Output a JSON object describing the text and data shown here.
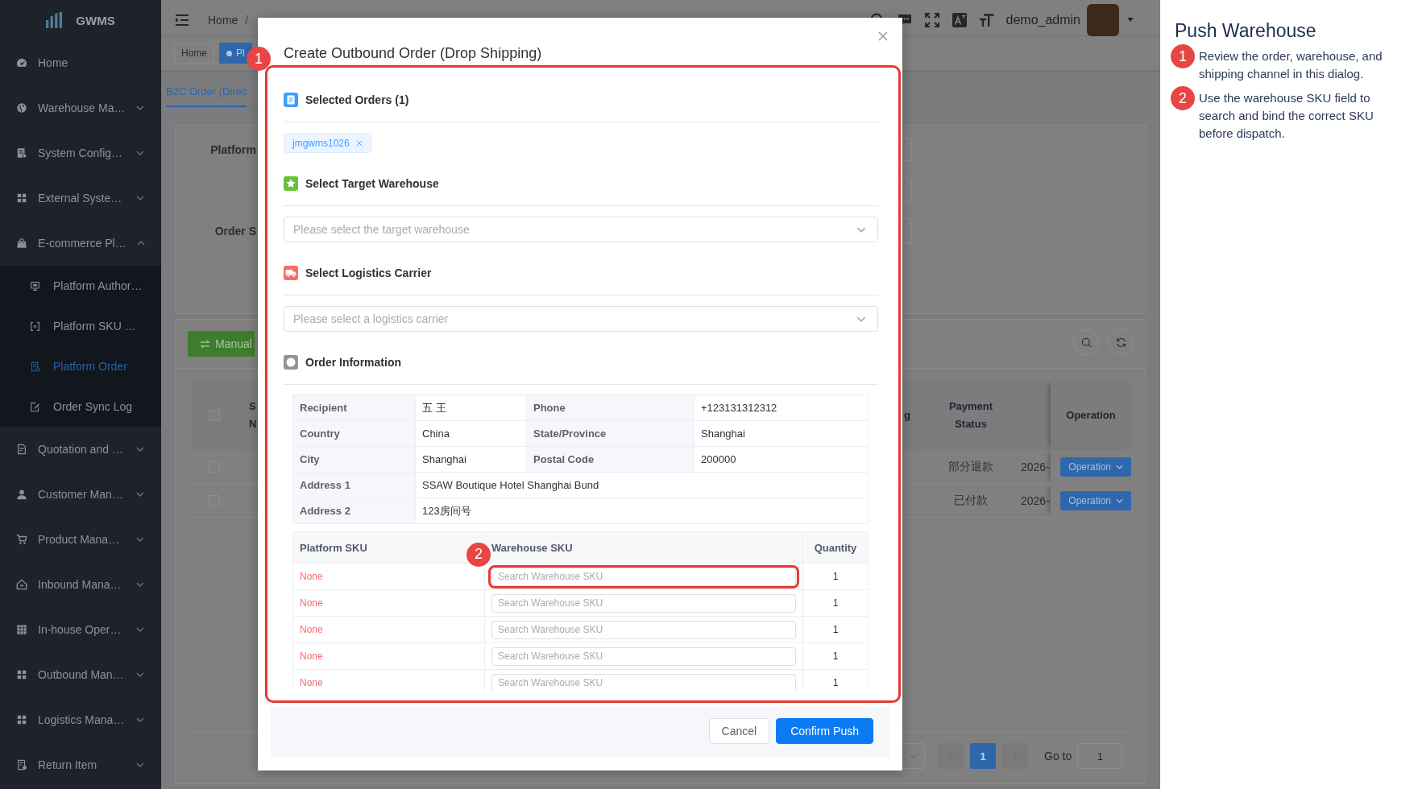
{
  "sidebar": {
    "logo": "GWMS",
    "items": [
      {
        "label": "Home",
        "kind": "link"
      },
      {
        "label": "Warehouse Ma…",
        "kind": "group",
        "expanded": false
      },
      {
        "label": "System Config…",
        "kind": "group",
        "expanded": false
      },
      {
        "label": "External Syste…",
        "kind": "group",
        "expanded": false
      },
      {
        "label": "E-commerce Pl…",
        "kind": "group",
        "expanded": true,
        "children": [
          {
            "label": "Platform Author…",
            "selected": false
          },
          {
            "label": "Platform SKU …",
            "selected": false
          },
          {
            "label": "Platform Order",
            "selected": true
          },
          {
            "label": "Order Sync Log",
            "selected": false
          }
        ]
      },
      {
        "label": "Quotation and …",
        "kind": "group",
        "expanded": false
      },
      {
        "label": "Customer Man…",
        "kind": "group",
        "expanded": false
      },
      {
        "label": "Product Mana…",
        "kind": "group",
        "expanded": false
      },
      {
        "label": "Inbound Mana…",
        "kind": "group",
        "expanded": false
      },
      {
        "label": "In-house Oper…",
        "kind": "group",
        "expanded": false
      },
      {
        "label": "Outbound Man…",
        "kind": "group",
        "expanded": false
      },
      {
        "label": "Logistics Mana…",
        "kind": "group",
        "expanded": false
      },
      {
        "label": "Return Item",
        "kind": "group",
        "expanded": false
      }
    ]
  },
  "topbar": {
    "breadcrumb": [
      {
        "label": "Home"
      }
    ],
    "separator": "/",
    "user": "demo_admin"
  },
  "tags": [
    {
      "label": "Home",
      "selected": false
    },
    {
      "label": "Pl",
      "selected": true
    }
  ],
  "page_tabs": [
    {
      "label": "B2C Order (Direc",
      "selected": true
    }
  ],
  "filter": {
    "labels": [
      "Platform",
      "Order S"
    ]
  },
  "toolbar": {
    "button": "Manual"
  },
  "table": {
    "select_all": false,
    "columns": [
      {
        "label": "S N"
      },
      {
        "label": "g"
      },
      {
        "label": "Payment Status"
      },
      {
        "label": "Operation"
      }
    ],
    "rows": [
      {
        "checked": false,
        "payment_status": "部分退款",
        "column_4": "2026-",
        "operation": "Operation"
      },
      {
        "checked": false,
        "payment_status": "已付款",
        "column_4": "2026-",
        "operation": "Operation"
      }
    ]
  },
  "pagination": {
    "pages": [
      {
        "label": "1",
        "selected": true
      }
    ],
    "goto_label": "Go to",
    "goto_value": "1"
  },
  "dialog": {
    "title": "Create Outbound Order (Drop Shipping)",
    "sections": [
      {
        "kind": "orders",
        "title": "Selected Orders (1)",
        "tags": [
          "jmgwms1026"
        ]
      },
      {
        "kind": "warehouse",
        "title": "Select Target Warehouse",
        "placeholder": "Please select the target warehouse"
      },
      {
        "kind": "carrier",
        "title": "Select Logistics Carrier",
        "placeholder": "Please select a logistics carrier"
      },
      {
        "kind": "info",
        "title": "Order Information"
      }
    ],
    "order_info": [
      {
        "cells": [
          {
            "label": "Recipient",
            "value": "五 王"
          },
          {
            "label": "Phone",
            "value": "+123131312312"
          }
        ]
      },
      {
        "cells": [
          {
            "label": "Country",
            "value": "China"
          },
          {
            "label": "State/Province",
            "value": "Shanghai"
          }
        ]
      },
      {
        "cells": [
          {
            "label": "City",
            "value": "Shanghai"
          },
          {
            "label": "Postal Code",
            "value": "200000"
          }
        ]
      },
      {
        "cells": [
          {
            "label": "Address 1",
            "value": "SSAW Boutique Hotel Shanghai Bund"
          }
        ]
      },
      {
        "cells": [
          {
            "label": "Address 2",
            "value": "123房间号"
          }
        ]
      }
    ],
    "sku_table": {
      "columns": [
        "Platform SKU",
        "Warehouse SKU",
        "Quantity"
      ],
      "rows": [
        {
          "platform_sku": "None",
          "placeholder": "Search Warehouse SKU",
          "quantity": "1"
        },
        {
          "platform_sku": "None",
          "placeholder": "Search Warehouse SKU",
          "quantity": "1"
        },
        {
          "platform_sku": "None",
          "placeholder": "Search Warehouse SKU",
          "quantity": "1"
        },
        {
          "platform_sku": "None",
          "placeholder": "Search Warehouse SKU",
          "quantity": "1"
        },
        {
          "platform_sku": "None",
          "placeholder": "Search Warehouse SKU",
          "quantity": "1"
        }
      ]
    },
    "buttons": [
      {
        "label": "Cancel",
        "kind": "default"
      },
      {
        "label": "Confirm Push",
        "kind": "primary"
      }
    ]
  },
  "annotations": [
    {
      "number": "1"
    },
    {
      "number": "2"
    }
  ],
  "guide": {
    "title": "Push Warehouse",
    "steps": [
      {
        "number": "1",
        "text": "Review the order, warehouse, and shipping channel in this dialog."
      },
      {
        "number": "2",
        "text": "Use the warehouse SKU field to search and bind the correct SKU before dispatch."
      }
    ]
  }
}
